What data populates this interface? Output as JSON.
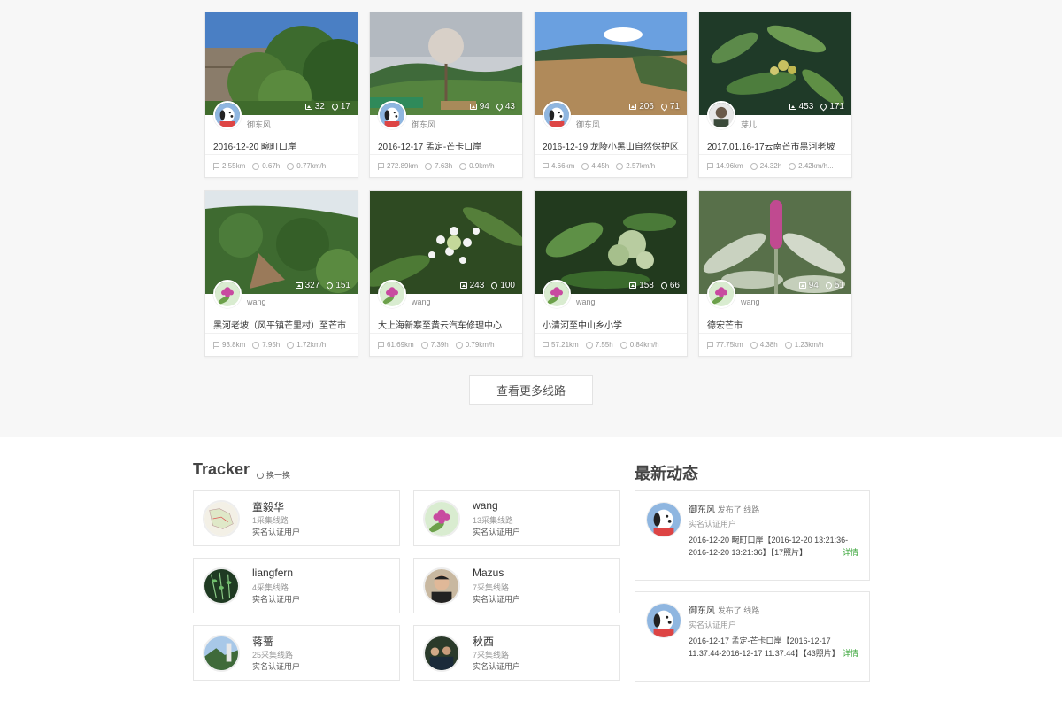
{
  "routes": [
    {
      "author": "御东风",
      "title": "2016-12-20 畹町口岸",
      "photos": "32",
      "points": "17",
      "distance": "2.55km",
      "duration": "0.67h",
      "speed": "0.77km/h",
      "avatar": "snoopy",
      "photo": "p1"
    },
    {
      "author": "御东风",
      "title": "2016-12-17 孟定-芒卡口岸",
      "photos": "94",
      "points": "43",
      "distance": "272.89km",
      "duration": "7.63h",
      "speed": "0.9km/h",
      "avatar": "snoopy",
      "photo": "p2"
    },
    {
      "author": "御东风",
      "title": "2016-12-19 龙陵小黑山自然保护区",
      "photos": "206",
      "points": "71",
      "distance": "4.66km",
      "duration": "4.45h",
      "speed": "2.57km/h",
      "avatar": "snoopy",
      "photo": "p3"
    },
    {
      "author": "芽儿",
      "title": "2017.01.16-17云南芒市黑河老坡",
      "photos": "453",
      "points": "171",
      "distance": "14.96km",
      "duration": "24.32h",
      "speed": "2.42km/h...",
      "avatar": "man",
      "photo": "p4"
    },
    {
      "author": "wang",
      "title": "黑河老坡（风平镇芒里村）至芒市",
      "photos": "327",
      "points": "151",
      "distance": "93.8km",
      "duration": "7.95h",
      "speed": "1.72km/h",
      "avatar": "flower",
      "photo": "p5"
    },
    {
      "author": "wang",
      "title": "大上海新寨至黄云汽车修理中心",
      "photos": "243",
      "points": "100",
      "distance": "61.69km",
      "duration": "7.39h",
      "speed": "0.79km/h",
      "avatar": "flower",
      "photo": "p6"
    },
    {
      "author": "wang",
      "title": "小清河至中山乡小学",
      "photos": "158",
      "points": "66",
      "distance": "57.21km",
      "duration": "7.55h",
      "speed": "0.84km/h",
      "avatar": "flower",
      "photo": "p7"
    },
    {
      "author": "wang",
      "title": "德宏芒市",
      "photos": "94",
      "points": "51",
      "distance": "77.75km",
      "duration": "4.38h",
      "speed": "1.23km/h",
      "avatar": "flower",
      "photo": "p8"
    }
  ],
  "more_button": "查看更多线路",
  "tracker": {
    "title": "Tracker",
    "refresh": "换一换",
    "users": [
      {
        "name": "童毅华",
        "count": "1采集线路",
        "verify": "实名认证用户",
        "avatar": "map"
      },
      {
        "name": "wang",
        "count": "13采集线路",
        "verify": "实名认证用户",
        "avatar": "flower"
      },
      {
        "name": "liangfern",
        "count": "4采集线路",
        "verify": "实名认证用户",
        "avatar": "leaf"
      },
      {
        "name": "Mazus",
        "count": "7采集线路",
        "verify": "实名认证用户",
        "avatar": "face"
      },
      {
        "name": "蒋蔷",
        "count": "25采集线路",
        "verify": "实名认证用户",
        "avatar": "landscape"
      },
      {
        "name": "秋西",
        "count": "7采集线路",
        "verify": "实名认证用户",
        "avatar": "group"
      }
    ]
  },
  "activity": {
    "title": "最新动态",
    "items": [
      {
        "user": "御东风",
        "action": "发布了 线路",
        "verify": "实名认证用户",
        "desc": "2016-12-20 畹町口岸【2016-12-20 13:21:36-2016-12-20 13:21:36】【17照片】",
        "detail": "详情"
      },
      {
        "user": "御东风",
        "action": "发布了 线路",
        "verify": "实名认证用户",
        "desc": "2016-12-17 孟定-芒卡口岸【2016-12-17 11:37:44-2016-12-17 11:37:44】【43照片】",
        "detail": "详情"
      }
    ]
  },
  "colors": {
    "accent_green": "#3aa63a",
    "bg_top": "#f7f7f7"
  }
}
